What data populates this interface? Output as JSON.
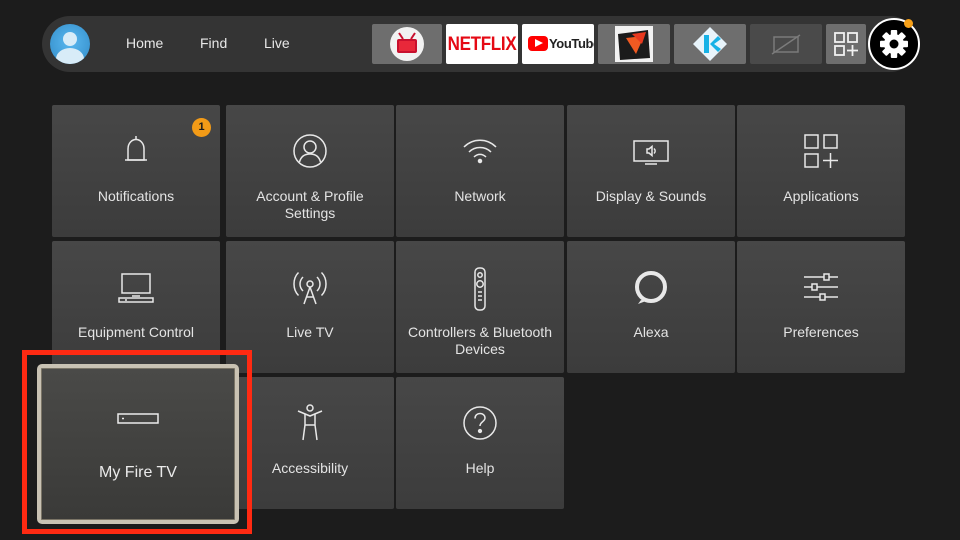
{
  "nav": {
    "links": [
      {
        "label": "Home"
      },
      {
        "label": "Find"
      },
      {
        "label": "Live"
      }
    ],
    "apps": [
      {
        "name": "redbox-tv-icon"
      },
      {
        "name": "netflix-app",
        "text": "NETFLIX"
      },
      {
        "name": "youtube-app",
        "text": "YouTube"
      },
      {
        "name": "downloader-icon"
      },
      {
        "name": "kodi-icon"
      },
      {
        "name": "placeholder-app-icon"
      },
      {
        "name": "all-apps-icon"
      }
    ],
    "settings_icon": "gear-icon",
    "notification_dot_color": "#f7a018"
  },
  "settings_tiles": [
    {
      "id": "notifications",
      "label": "Notifications",
      "icon": "bell-icon",
      "badge": "1"
    },
    {
      "id": "account",
      "label": "Account & Profile Settings",
      "icon": "user-icon"
    },
    {
      "id": "network",
      "label": "Network",
      "icon": "wifi-icon"
    },
    {
      "id": "display",
      "label": "Display & Sounds",
      "icon": "tv-speaker-icon"
    },
    {
      "id": "applications",
      "label": "Applications",
      "icon": "apps-grid-icon"
    },
    {
      "id": "equipment",
      "label": "Equipment Control",
      "icon": "monitor-icon"
    },
    {
      "id": "livetv",
      "label": "Live TV",
      "icon": "antenna-icon"
    },
    {
      "id": "controllers",
      "label": "Controllers & Bluetooth Devices",
      "icon": "remote-icon"
    },
    {
      "id": "alexa",
      "label": "Alexa",
      "icon": "alexa-icon"
    },
    {
      "id": "preferences",
      "label": "Preferences",
      "icon": "sliders-icon"
    },
    {
      "id": "myfiretv",
      "label": "My Fire TV",
      "icon": "fire-tv-device-icon",
      "focused": true
    },
    {
      "id": "accessibility",
      "label": "Accessibility",
      "icon": "accessibility-icon"
    },
    {
      "id": "help",
      "label": "Help",
      "icon": "help-icon"
    }
  ],
  "colors": {
    "background": "#1c1c1c",
    "tile": "#434343",
    "highlight": "#ff2a12",
    "badge": "#f39b17"
  }
}
